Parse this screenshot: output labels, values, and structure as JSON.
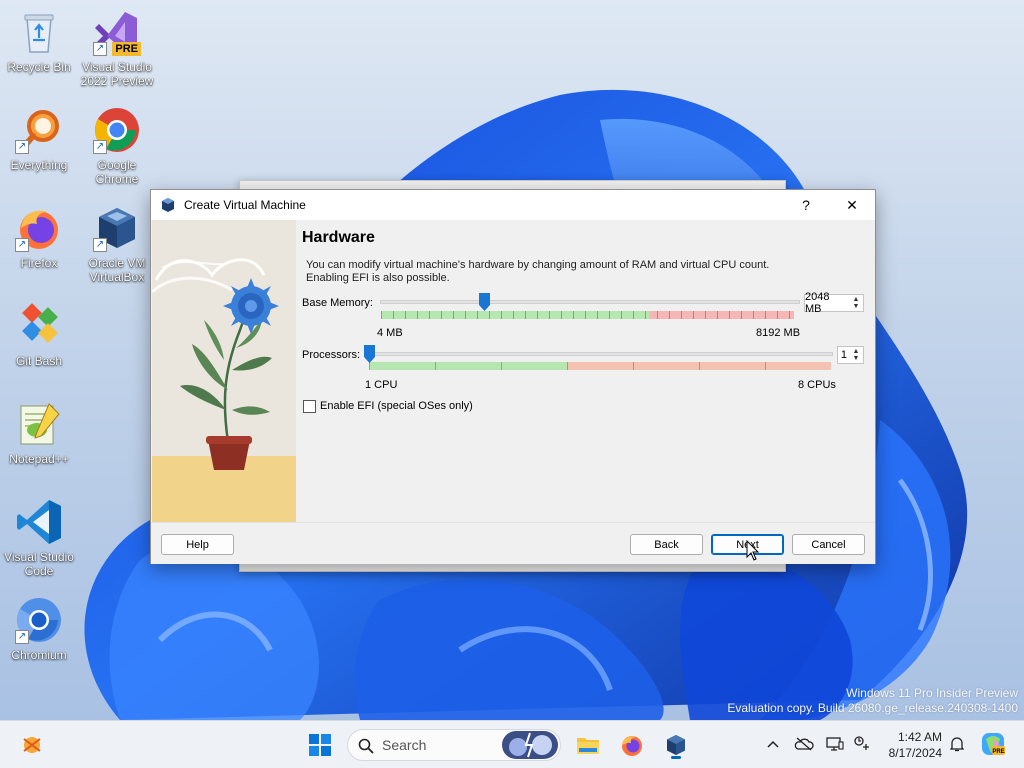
{
  "desktop": {
    "icons": [
      {
        "label": "Recycle Bin",
        "icon": "recycle-bin-icon"
      },
      {
        "label": "Visual Studio 2022 Preview",
        "label_line1": "Visual Studio",
        "label_line2": "2022 Preview",
        "icon": "visual-studio-icon",
        "badge": "PRE"
      },
      {
        "label": "Everything",
        "icon": "everything-search-icon"
      },
      {
        "label": "Google Chrome",
        "label_line1": "Google",
        "label_line2": "Chrome",
        "icon": "chrome-icon"
      },
      {
        "label": "Firefox",
        "icon": "firefox-icon"
      },
      {
        "label": "Oracle VM VirtualBox",
        "label_line1": "Oracle VM",
        "label_line2": "VirtualBox",
        "icon": "virtualbox-icon"
      },
      {
        "label": "Git Bash",
        "icon": "git-bash-icon"
      },
      {
        "label": "Notepad++",
        "icon": "notepadpp-icon"
      },
      {
        "label": "Visual Studio Code",
        "label_line1": "Visual Studio",
        "label_line2": "Code",
        "icon": "vscode-icon"
      },
      {
        "label": "Chromium",
        "icon": "chromium-icon"
      }
    ],
    "watermark_line1": "Windows 11 Pro Insider Preview",
    "watermark_line2": "Evaluation copy. Build 26080.ge_release.240308-1400"
  },
  "dialog": {
    "title": "Create Virtual Machine",
    "help_glyph": "?",
    "close_glyph": "✕",
    "heading": "Hardware",
    "description": "You can modify virtual machine's hardware by changing amount of RAM and virtual CPU count. Enabling EFI is also possible.",
    "description_line1": "You can modify virtual machine's hardware by changing amount of RAM and virtual CPU count.",
    "description_line2": "Enabling EFI is also possible.",
    "memory": {
      "label": "Base Memory:",
      "value": "2048 MB",
      "min_label": "4 MB",
      "max_label": "8192 MB",
      "min": 4,
      "max": 8192,
      "current": 2048
    },
    "processors": {
      "label": "Processors:",
      "value": "1",
      "min_label": "1 CPU",
      "max_label": "8 CPUs",
      "min": 1,
      "max": 8,
      "current": 1
    },
    "efi": {
      "label": "Enable EFI (special OSes only)",
      "checked": false
    },
    "buttons": {
      "help": "Help",
      "back": "Back",
      "next": "Next",
      "cancel": "Cancel"
    }
  },
  "taskbar": {
    "search_placeholder": "Search",
    "time": "1:42 AM",
    "date": "8/17/2024",
    "pinned": [
      "start-icon",
      "file-explorer-icon",
      "firefox-icon",
      "virtualbox-icon"
    ],
    "tray": [
      "chevron-up-icon",
      "onedrive-icon",
      "display-icon",
      "accessibility-icon",
      "notification-bell-icon",
      "copilot-icon"
    ]
  },
  "colors": {
    "accent": "#0067c0",
    "memory_good": "#b6e7b1",
    "memory_bad": "#f6b6b6",
    "cpu_warn": "#f4c2b0"
  }
}
